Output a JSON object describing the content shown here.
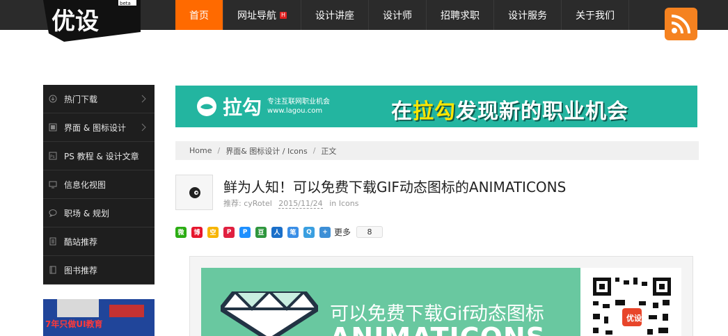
{
  "header": {
    "logo_text": "优设",
    "logo_beta": "beta",
    "nav": [
      {
        "label": "首页",
        "active": true
      },
      {
        "label": "网址导航",
        "badge": "H"
      },
      {
        "label": "设计讲座"
      },
      {
        "label": "设计师"
      },
      {
        "label": "招聘求职"
      },
      {
        "label": "设计服务"
      },
      {
        "label": "关于我们"
      }
    ],
    "rss_icon": "rss-icon"
  },
  "sidebar": {
    "items": [
      {
        "label": "热门下载",
        "icon": "download-icon",
        "has_arrow": true
      },
      {
        "label": "界面 & 图标设计",
        "icon": "interface-icon",
        "has_arrow": true
      },
      {
        "label": "PS 教程 & 设计文章",
        "icon": "ps-icon",
        "has_arrow": false
      },
      {
        "label": "信息化视图",
        "icon": "monitor-icon",
        "has_arrow": false
      },
      {
        "label": "职场 & 规划",
        "icon": "chat-icon",
        "has_arrow": false
      },
      {
        "label": "酷站推荐",
        "icon": "site-icon",
        "has_arrow": false
      },
      {
        "label": "图书推荐",
        "icon": "book-icon",
        "has_arrow": false
      }
    ],
    "ad_text": "7年只做UI教育"
  },
  "banner": {
    "brand": "拉勾",
    "tagline": "专注互联网职业机会",
    "url": "www.lagou.com",
    "slogan_prefix": "在",
    "slogan_highlight": "拉勾",
    "slogan_rest": "发现新的职业机会",
    "color": "#23b5a0"
  },
  "breadcrumb": {
    "home": "Home",
    "category": "界面& 图标设计 / Icons",
    "current": "正文"
  },
  "post": {
    "title": "鲜为人知！可以免费下载GIF动态图标的ANIMATICONS",
    "author_label": "推荐: cyRotel",
    "date": "2015/11/24",
    "category": "in Icons"
  },
  "share": {
    "buttons": [
      {
        "name": "wechat-share-icon",
        "color": "#2bad13",
        "glyph": "微"
      },
      {
        "name": "weibo-share-icon",
        "color": "#e6162d",
        "glyph": "博"
      },
      {
        "name": "qzone-share-icon",
        "color": "#f7b500",
        "glyph": "空"
      },
      {
        "name": "pocket-share-icon",
        "color": "#e02040",
        "glyph": "P"
      },
      {
        "name": "reader-share-icon",
        "color": "#1e90ff",
        "glyph": "P"
      },
      {
        "name": "douban-share-icon",
        "color": "#2e963d",
        "glyph": "豆"
      },
      {
        "name": "renren-share-icon",
        "color": "#1a6fc9",
        "glyph": "人"
      },
      {
        "name": "feather-share-icon",
        "color": "#3a8ee6",
        "glyph": "笔"
      },
      {
        "name": "qq-share-icon",
        "color": "#3a9fe0",
        "glyph": "Q"
      },
      {
        "name": "more-share-icon",
        "color": "#3d8fd6",
        "glyph": "+"
      }
    ],
    "more_label": "更多",
    "count": "8"
  },
  "figure": {
    "headline": "可以免费下载Gif动态图标",
    "big_text": "ANIMATICONS",
    "green": "#69c8a0",
    "qr_label": "优设"
  }
}
